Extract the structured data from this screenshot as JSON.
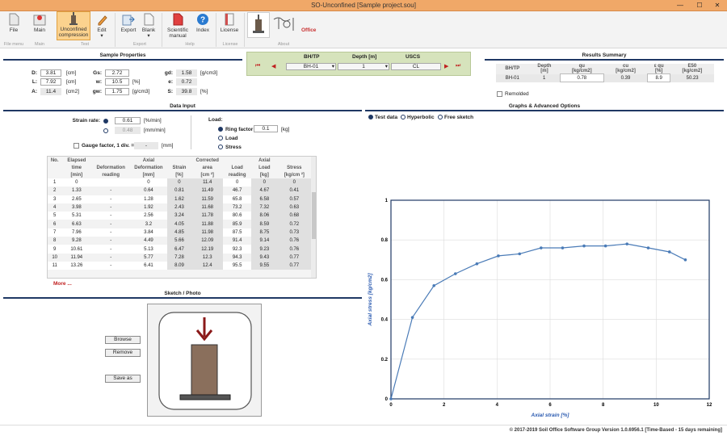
{
  "window": {
    "title": "SO-Unconfined [Sample project.sou]",
    "min": "—",
    "max": "☐",
    "close": "✕"
  },
  "ribbon": {
    "buttons": {
      "file": "File",
      "main": "Main",
      "unconfined": "Unconfined\ncompression",
      "edit": "Edit",
      "export": "Export",
      "blank": "Blank",
      "manual": "Scientific\nmanual",
      "index": "Index",
      "license": "License"
    },
    "groups": {
      "file_menu": "File menu",
      "main": "Main",
      "test": "Test",
      "export": "Export",
      "help": "Help",
      "license": "License",
      "about": "About"
    },
    "logo_text": "Office"
  },
  "sample": {
    "header": "Sample Properties",
    "D": {
      "label": "D:",
      "value": "3.81",
      "unit": "[cm]"
    },
    "L": {
      "label": "L:",
      "value": "7.92",
      "unit": "[cm]"
    },
    "A": {
      "label": "A:",
      "value": "11.4",
      "unit": "[cm2]"
    },
    "Gs": {
      "label": "Gs:",
      "value": "2.72"
    },
    "w": {
      "label": "w:",
      "value": "10.5",
      "unit": "[%]"
    },
    "gw": {
      "label": "gw:",
      "value": "1.75",
      "unit": "[g/cm3]"
    },
    "gd": {
      "label": "gd:",
      "value": "1.58",
      "unit": "[g/cm3]"
    },
    "e": {
      "label": "e:",
      "value": "0.72"
    },
    "S": {
      "label": "S:",
      "value": "39.8",
      "unit": "[%]"
    }
  },
  "nav": {
    "bh_label": "BH/TP",
    "depth_label": "Depth [m]",
    "uscs_label": "USCS",
    "bh_value": "BH-01",
    "depth_value": "1",
    "uscs_value": "CL",
    "first": "⏮",
    "prev": "◀",
    "next": "▶",
    "last": "⏭"
  },
  "results": {
    "header": "Results Summary",
    "columns": [
      "BH/TP",
      "Depth\n[m]",
      "qu\n[kg/cm2]",
      "cu\n[kg/cm2]",
      "ε qu\n[%]",
      "E50\n[kg/cm2]"
    ],
    "row": [
      "BH-01",
      "1",
      "0.78",
      "0.39",
      "8.9",
      "50.23"
    ],
    "remolded": "Remolded"
  },
  "datainput": {
    "header": "Data Input",
    "strain_rate_label": "Strain rate:",
    "rate1": "0.61",
    "rate1_unit": "[%/min]",
    "rate2": "0.48",
    "rate2_unit": "[mm/min]",
    "gauge_label": "Gauge factor, 1 div. =",
    "gauge_value": "-",
    "gauge_unit": "[mm]",
    "load_label": "Load:",
    "ring_factor_label": "Ring factor",
    "ring_factor_value": "0.1",
    "ring_factor_unit": "[kg]",
    "load_opt": "Load",
    "stress_opt": "Stress",
    "more": "More ..."
  },
  "table": {
    "headers1": [
      "No.",
      "Elapsed",
      "",
      "Axial",
      "",
      "Corrected",
      "",
      "Axial",
      ""
    ],
    "headers2": [
      "",
      "time",
      "Deformation",
      "Deformation",
      "Strain",
      "area",
      "Load",
      "Load",
      "Stress"
    ],
    "headers3": [
      "",
      "[min]",
      "reading",
      "[mm]",
      "[%]",
      "[cm ²]",
      "reading",
      "[kg]",
      "[kg/cm ²]"
    ],
    "rows": [
      [
        "1",
        "0",
        "",
        "0",
        "0",
        "11.4",
        "0",
        "0",
        "0"
      ],
      [
        "2",
        "1.33",
        "-",
        "0.64",
        "0.81",
        "11.49",
        "46.7",
        "4.67",
        "0.41"
      ],
      [
        "3",
        "2.65",
        "-",
        "1.28",
        "1.62",
        "11.59",
        "65.8",
        "6.58",
        "0.57"
      ],
      [
        "4",
        "3.98",
        "-",
        "1.92",
        "2.43",
        "11.68",
        "73.2",
        "7.32",
        "0.63"
      ],
      [
        "5",
        "5.31",
        "-",
        "2.56",
        "3.24",
        "11.78",
        "80.6",
        "8.06",
        "0.68"
      ],
      [
        "6",
        "6.63",
        "-",
        "3.2",
        "4.05",
        "11.88",
        "85.9",
        "8.59",
        "0.72"
      ],
      [
        "7",
        "7.96",
        "-",
        "3.84",
        "4.85",
        "11.98",
        "87.5",
        "8.75",
        "0.73"
      ],
      [
        "8",
        "9.28",
        "-",
        "4.49",
        "5.66",
        "12.09",
        "91.4",
        "9.14",
        "0.76"
      ],
      [
        "9",
        "10.61",
        "-",
        "5.13",
        "6.47",
        "12.19",
        "92.3",
        "9.23",
        "0.76"
      ],
      [
        "10",
        "11.94",
        "-",
        "5.77",
        "7.28",
        "12.3",
        "94.3",
        "9.43",
        "0.77"
      ],
      [
        "11",
        "13.26",
        "-",
        "6.41",
        "8.09",
        "12.4",
        "95.5",
        "9.55",
        "0.77"
      ]
    ]
  },
  "sketch": {
    "header": "Sketch / Photo",
    "browse": "Browse",
    "remove": "Remove",
    "save": "Save as"
  },
  "graphs": {
    "header": "Graphs & Advanced Options",
    "opt_test": "Test data",
    "opt_hyper": "Hyperbolic",
    "opt_free": "Free sketch"
  },
  "chart_data": {
    "type": "line",
    "xlabel": "Axial strain [%]",
    "ylabel": "Axial stress [kg/cm2]",
    "xlim": [
      0,
      12
    ],
    "ylim": [
      0,
      1
    ],
    "xticks": [
      "0",
      "2",
      "4",
      "6",
      "8",
      "10",
      "12"
    ],
    "yticks": [
      "0",
      "0.2",
      "0.4",
      "0.6",
      "0.8",
      "1"
    ],
    "grid": true,
    "color": "#4a7bb7",
    "x": [
      0,
      0.81,
      1.62,
      2.43,
      3.24,
      4.05,
      4.85,
      5.66,
      6.47,
      7.28,
      8.09,
      8.9,
      9.7,
      10.5,
      11.1
    ],
    "y": [
      0,
      0.41,
      0.57,
      0.63,
      0.68,
      0.72,
      0.73,
      0.76,
      0.76,
      0.77,
      0.77,
      0.78,
      0.76,
      0.74,
      0.7
    ]
  },
  "status": "© 2017-2019 Soil Office Software Group   Version 1.0.6956.1 [Time-Based - 15 days remaining]"
}
